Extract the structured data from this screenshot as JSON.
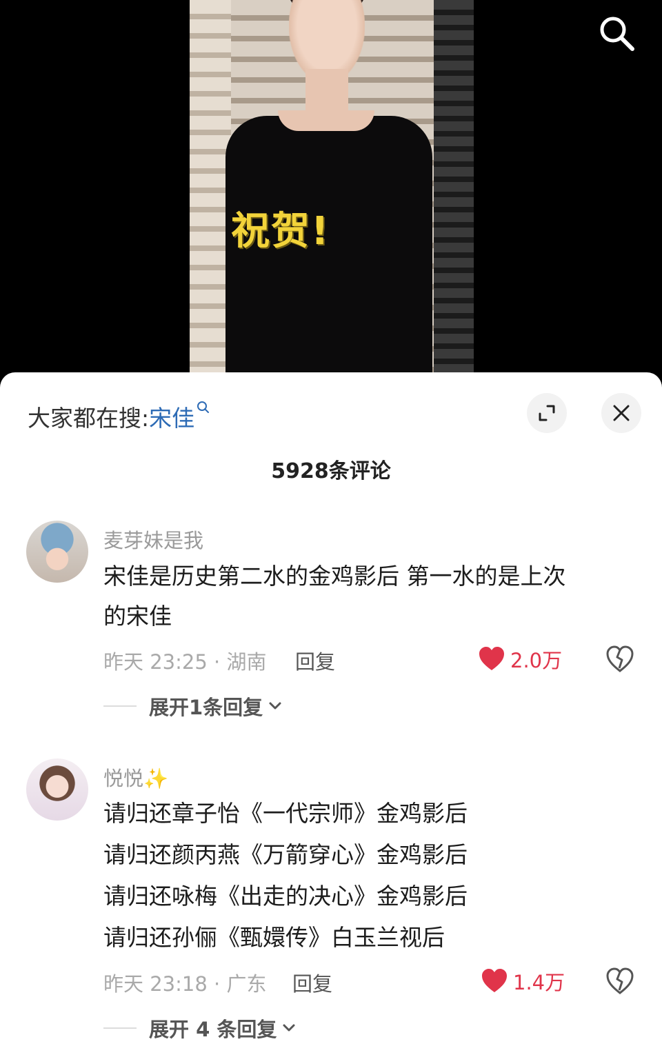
{
  "video": {
    "overlay_text": "祝贺!",
    "search_icon": "search-icon"
  },
  "sheet": {
    "search_prefix": "大家都在搜:",
    "search_keyword": "宋佳",
    "comment_count": "5928条评论",
    "expand_icon": "expand-icon",
    "close_icon": "close-icon"
  },
  "comments": [
    {
      "username": "麦芽妹是我",
      "lines": [
        "宋佳是历史第二水的金鸡影后 第一水的是上次",
        "的宋佳"
      ],
      "time_location": "昨天 23:25 · 湖南",
      "reply_label": "回复",
      "likes": "2.0万",
      "expand_replies": "展开1条回复"
    },
    {
      "username": "悦悦",
      "username_emoji": "✨",
      "lines": [
        "请归还章子怡《一代宗师》金鸡影后",
        "请归还颜丙燕《万箭穿心》金鸡影后",
        "请归还咏梅《出走的决心》金鸡影后",
        "请归还孙俪《甄嬛传》白玉兰视后"
      ],
      "time_location": "昨天 23:18 · 广东",
      "reply_label": "回复",
      "likes": "1.4万",
      "expand_replies": "展开 4 条回复"
    }
  ],
  "colors": {
    "like": "#e0344a",
    "keyword": "#2d6bb5",
    "overlay": "#f2d33a"
  }
}
